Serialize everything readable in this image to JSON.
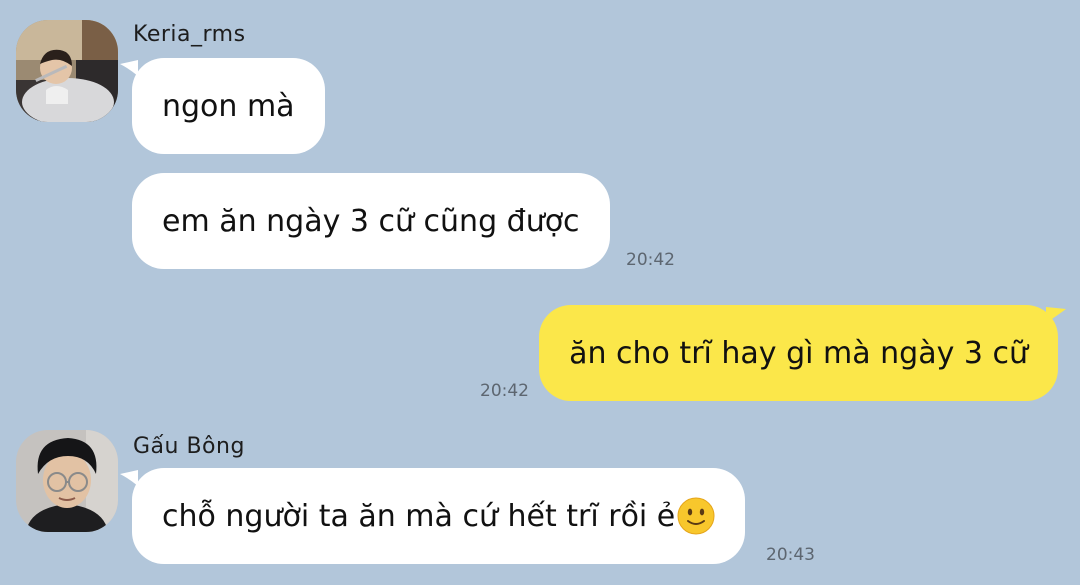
{
  "colors": {
    "background": "#b2c6da",
    "incoming_bubble": "#ffffff",
    "outgoing_bubble": "#fbe74a",
    "timestamp": "#5d6670"
  },
  "messages": [
    {
      "sender": "Keria_rms",
      "direction": "incoming",
      "text": "ngon mà",
      "time": ""
    },
    {
      "sender": "Keria_rms",
      "direction": "incoming",
      "text": "em ăn ngày 3 cữ cũng được",
      "time": "20:42"
    },
    {
      "sender": "",
      "direction": "outgoing",
      "text": "ăn cho trĩ hay gì mà ngày 3 cữ",
      "time": "20:42"
    },
    {
      "sender": "Gấu Bông",
      "direction": "incoming",
      "text": "chỗ người ta ăn mà cứ hết trĩ rồi ẻ",
      "emoji": "slightly-smiling-face-emoji",
      "time": "20:43"
    }
  ]
}
